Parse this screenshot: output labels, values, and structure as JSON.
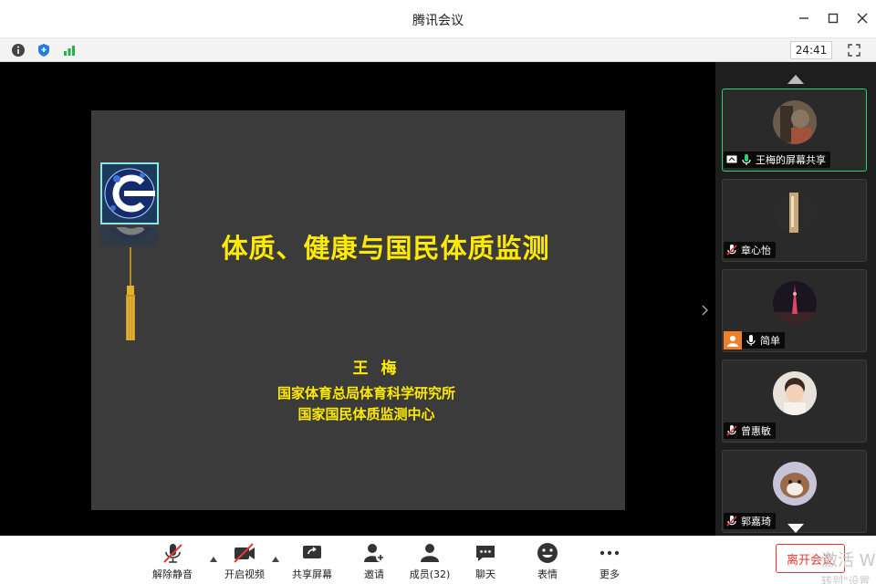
{
  "window": {
    "title": "腾讯会议"
  },
  "infobar": {
    "timer": "24:41",
    "icons": [
      "info-icon",
      "shield-icon",
      "signal-icon",
      "fullscreen-icon"
    ]
  },
  "slide": {
    "title": "体质、健康与国民体质监测",
    "author": "王梅",
    "org_line1": "国家体育总局体育科学研究所",
    "org_line2": "国家国民体质监测中心",
    "text_color": "#ffea00",
    "background": "#3b3b3b"
  },
  "participants": [
    {
      "name": "王梅的屏幕共享",
      "mic": "on",
      "status_icon": "screen-share-icon",
      "active": true
    },
    {
      "name": "章心怡",
      "mic": "muted"
    },
    {
      "name": "简单",
      "mic": "on",
      "status_icon": "user-icon"
    },
    {
      "name": "曾惠敏",
      "mic": "muted"
    },
    {
      "name": "郭嘉琦",
      "mic": "muted"
    }
  ],
  "toolbar": {
    "unmute": "解除静音",
    "start_video": "开启视频",
    "share_screen": "共享屏幕",
    "invite": "邀请",
    "members": "成员(32)",
    "chat": "聊天",
    "reactions": "表情",
    "more": "更多",
    "leave": "离开会议"
  },
  "watermark": {
    "line1": "激活 W",
    "line2": "转到\"设置"
  },
  "colors": {
    "accent_green": "#2bd17a",
    "leave_red": "#e53935",
    "panel_bg": "#1e1e1e"
  }
}
